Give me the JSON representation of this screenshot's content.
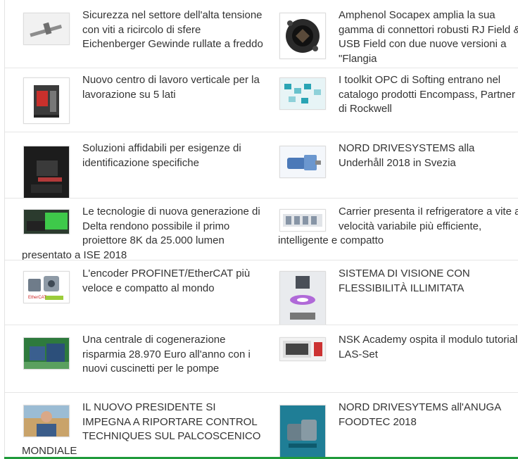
{
  "items": [
    {
      "title": "Sicurezza nel settore dell'alta tensione con viti a ricircolo di sfere Eichenberger Gewinde rullate a freddo",
      "thumb_icon": "screw-image"
    },
    {
      "title": "Amphenol Socapex amplia la sua gamma di connettori robusti RJ Field & USB Field con due nuove versioni a \"Flangia",
      "thumb_icon": "connector-image"
    },
    {
      "title": "Nuovo centro di lavoro verticale per la lavorazione su 5 lati",
      "thumb_icon": "machining-center-image"
    },
    {
      "title": "I toolkit OPC di Softing entrano nel catalogo prodotti Encompass, Partner di Rockwell",
      "thumb_icon": "softing-toolkit-image"
    },
    {
      "title": "Soluzioni affidabili per esigenze di identificazione specifiche",
      "thumb_icon": "identification-image"
    },
    {
      "title": "NORD DRIVESYSTEMS alla Underhåll 2018 in Svezia",
      "thumb_icon": "gear-motor-image"
    },
    {
      "title": "Le tecnologie di nuova generazione di Delta rendono possibile il primo proiettore 8K da 25.000 lumen presentato a ISE 2018",
      "thumb_icon": "projector-image"
    },
    {
      "title": "Carrier presenta iI refrigeratore a vite a velocità variabile più efficiente, intelligente e compatto",
      "thumb_icon": "chiller-image"
    },
    {
      "title": "L'encoder PROFINET/EtherCAT più veloce e compatto al mondo",
      "thumb_icon": "encoder-image",
      "thumb_badge": "EtherCAT"
    },
    {
      "title": "SISTEMA DI VISIONE CON FLESSIBILITÀ ILLIMITATA",
      "thumb_icon": "vision-system-image"
    },
    {
      "title": "Una centrale di cogenerazione risparmia 28.970 Euro all'anno con i nuovi cuscinetti per le pompe",
      "thumb_icon": "cogeneration-image"
    },
    {
      "title": "NSK Academy ospita il modulo tutorial LAS-Set",
      "thumb_icon": "tutorial-image"
    },
    {
      "title": "IL NUOVO PRESIDENTE SI IMPEGNA A RIPORTARE CONTROL TECHNIQUES SUL PALCOSCENICO MONDIALE",
      "thumb_icon": "president-portrait-image"
    },
    {
      "title": "NORD DRIVESYTEMS all'ANUGA FOODTEC 2018",
      "thumb_icon": "food-gearbox-image"
    }
  ],
  "colors": {
    "text": "#333333",
    "divider": "#e6e6e6",
    "accent": "#1f9a3a"
  }
}
